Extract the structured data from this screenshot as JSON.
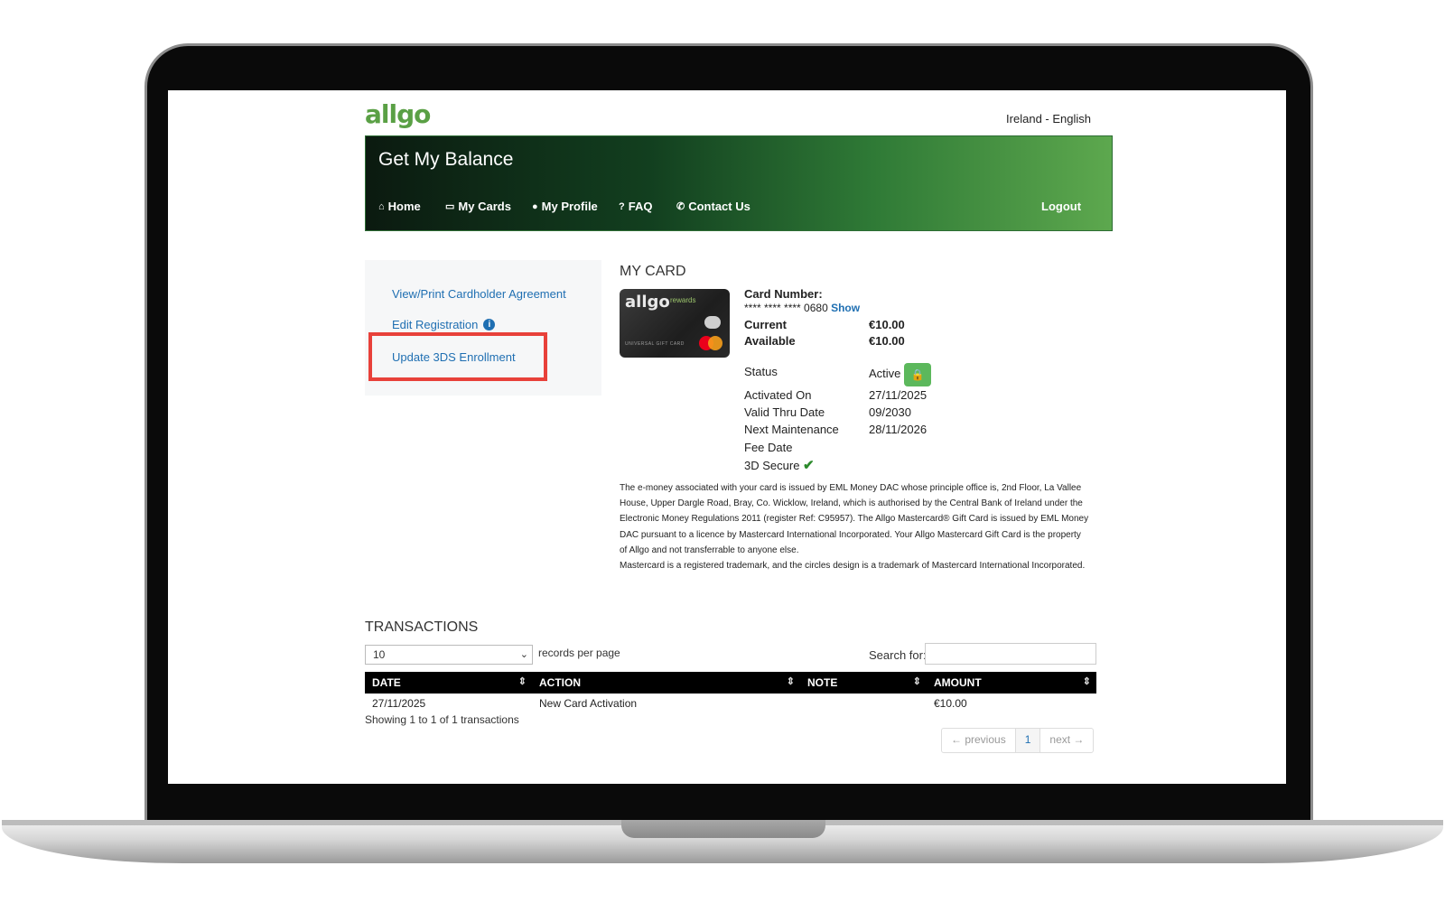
{
  "brand": {
    "logo_text": "allgo",
    "locale": "Ireland - English"
  },
  "hero": {
    "title": "Get My Balance"
  },
  "nav": {
    "items": [
      {
        "label": "Home",
        "icon": "home-icon"
      },
      {
        "label": "My Cards",
        "icon": "credit-card-icon"
      },
      {
        "label": "My Profile",
        "icon": "user-icon"
      },
      {
        "label": "FAQ",
        "icon": "question-circle-icon"
      },
      {
        "label": "Contact Us",
        "icon": "phone-icon"
      }
    ],
    "logout": "Logout"
  },
  "sidebar": {
    "links": [
      "View/Print Cardholder Agreement",
      "Edit Registration",
      "Update 3DS Enrollment"
    ]
  },
  "card": {
    "section_title": "MY CARD",
    "image": {
      "logo": "allgo",
      "tagline": "rewards",
      "subtitle": "UNIVERSAL GIFT CARD"
    },
    "number_label": "Card Number:",
    "number_masked": "**** **** **** 0680",
    "show_link": "Show",
    "current_label": "Current",
    "current_value": "€10.00",
    "available_label": "Available",
    "available_value": "€10.00",
    "status_label": "Status",
    "status_value": "Active",
    "activated_label": "Activated On",
    "activated_value": "27/11/2025",
    "valid_label": "Valid Thru Date",
    "valid_value": "09/2030",
    "maintenance_label": "Next Maintenance",
    "maintenance_value": "28/11/2026",
    "fee_label": "Fee Date",
    "secure_label": "3D Secure",
    "colors": {
      "accent_green": "#5cb85c",
      "link_blue": "#1f6fb2"
    }
  },
  "disclaimer": {
    "lines": [
      "The e-money associated with your card is issued by EML Money DAC whose principle office is, 2nd Floor, La Vallee",
      "House, Upper Dargle Road, Bray, Co. Wicklow, Ireland, which is authorised by the Central Bank of Ireland under the",
      "Electronic Money Regulations 2011 (register Ref: C95957). The Allgo Mastercard® Gift Card is issued by EML Money",
      "DAC pursuant to a licence by Mastercard International Incorporated. Your Allgo Mastercard Gift Card is the property",
      "of Allgo and not transferrable to anyone else.",
      "Mastercard is a registered trademark, and the circles design is a trademark of Mastercard International Incorporated."
    ]
  },
  "transactions": {
    "title": "TRANSACTIONS",
    "page_size": "10",
    "records_per_page": "records per page",
    "search_label": "Search for:",
    "columns": [
      "DATE",
      "ACTION",
      "NOTE",
      "AMOUNT"
    ],
    "rows": [
      [
        "27/11/2025",
        "New Card Activation",
        "",
        "€10.00"
      ]
    ],
    "summary": "Showing 1 to 1 of 1 transactions",
    "pager": {
      "previous": "← previous",
      "current": "1",
      "next": "next →"
    }
  }
}
